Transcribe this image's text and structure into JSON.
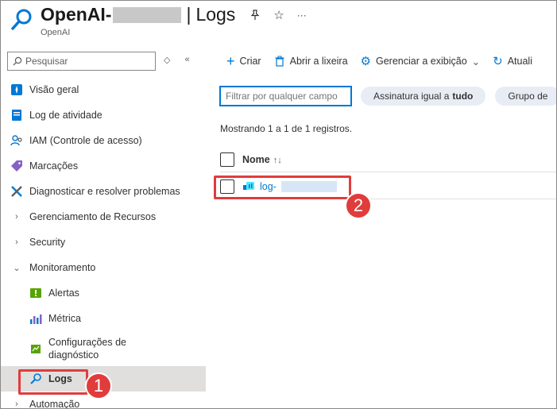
{
  "header": {
    "resource_name": "OpenAI-",
    "separator": "|",
    "page_title": "Logs",
    "subtitle": "OpenAI",
    "pin_icon": "pin-icon",
    "star_icon": "star-icon",
    "more_label": "···"
  },
  "sidebar": {
    "search_placeholder": "Pesquisar",
    "items": [
      {
        "label": "Visão geral",
        "icon": "overview-icon"
      },
      {
        "label": "Log de atividade",
        "icon": "activity-log-icon"
      },
      {
        "label": "IAM (Controle de acesso)",
        "icon": "iam-icon"
      },
      {
        "label": "Marcações",
        "icon": "tag-icon"
      },
      {
        "label": "Diagnosticar e resolver problemas",
        "icon": "wrench-icon"
      },
      {
        "label": "Gerenciamento de Recursos",
        "icon": "chevron-right-icon"
      },
      {
        "label": "Security",
        "icon": "chevron-right-icon"
      },
      {
        "label": "Monitoramento",
        "icon": "chevron-down-icon"
      },
      {
        "label": "Alertas",
        "icon": "alert-icon"
      },
      {
        "label": "Métrica",
        "icon": "metrics-icon"
      },
      {
        "label": "Configurações de diagnóstico",
        "icon": "diagnostic-settings-icon"
      },
      {
        "label": "Logs",
        "icon": "logs-search-icon"
      },
      {
        "label": "Automação",
        "icon": "chevron-right-icon"
      }
    ]
  },
  "toolbar": {
    "create": "Criar",
    "recycle": "Abrir a lixeira",
    "manage_view": "Gerenciar a exibição",
    "refresh": "Atuali"
  },
  "filters": {
    "placeholder": "Filtrar por qualquer campo",
    "subscription_prefix": "Assinatura igual a",
    "subscription_value": "tudo",
    "group": "Grupo de"
  },
  "records": {
    "summary": "Mostrando 1 a 1 de 1 registros.",
    "column_name": "Nome",
    "sort_glyph": "↑↓",
    "rows": [
      {
        "name": "log-"
      }
    ]
  },
  "callouts": {
    "step1": "1",
    "step2": "2"
  },
  "colors": {
    "accent": "#0078d4",
    "callout": "#e03c3c",
    "active_bg": "#e1dfdd"
  }
}
